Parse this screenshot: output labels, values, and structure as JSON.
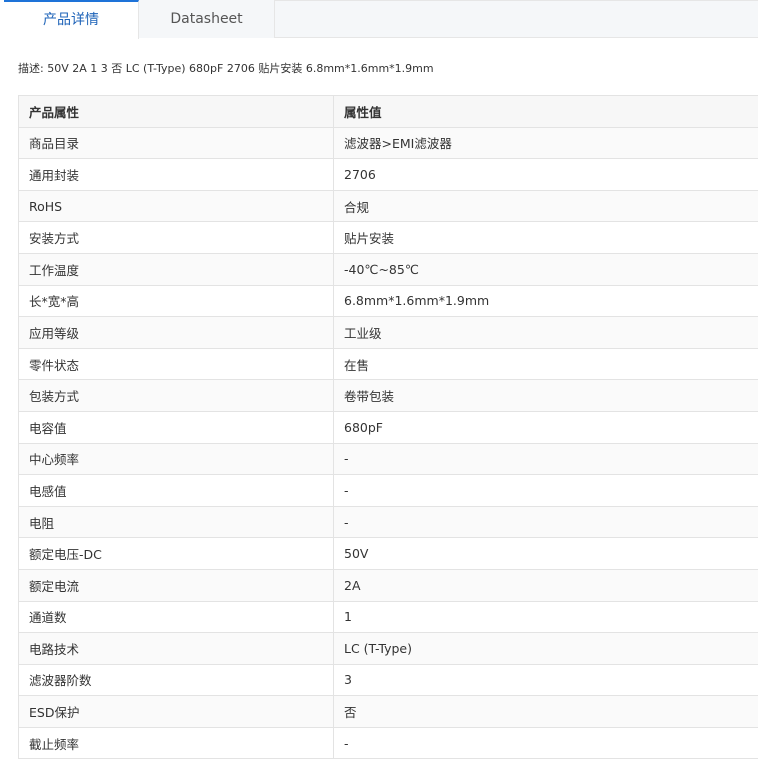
{
  "tabs": [
    {
      "label": "产品详情",
      "active": true
    },
    {
      "label": "Datasheet",
      "active": false
    }
  ],
  "description": "描述:  50V 2A 1 3 否 LC (T-Type) 680pF 2706 贴片安装 6.8mm*1.6mm*1.9mm",
  "table": {
    "headers": [
      "产品属性",
      "属性值"
    ],
    "rows": [
      [
        "商品目录",
        "滤波器>EMI滤波器"
      ],
      [
        "通用封装",
        "2706"
      ],
      [
        "RoHS",
        "合规"
      ],
      [
        "安装方式",
        "贴片安装"
      ],
      [
        "工作温度",
        "-40℃~85℃"
      ],
      [
        "长*宽*高",
        "6.8mm*1.6mm*1.9mm"
      ],
      [
        "应用等级",
        "工业级"
      ],
      [
        "零件状态",
        "在售"
      ],
      [
        "包装方式",
        "卷带包装"
      ],
      [
        "电容值",
        "680pF"
      ],
      [
        "中心频率",
        "-"
      ],
      [
        "电感值",
        "-"
      ],
      [
        "电阻",
        "-"
      ],
      [
        "额定电压-DC",
        "50V"
      ],
      [
        "额定电流",
        "2A"
      ],
      [
        "通道数",
        "1"
      ],
      [
        "电路技术",
        "LC (T-Type)"
      ],
      [
        "滤波器阶数",
        "3"
      ],
      [
        "ESD保护",
        "否"
      ],
      [
        "截止频率",
        "-"
      ]
    ]
  },
  "colors": {
    "accent": "#1e73d8",
    "active_tab_text": "#1e63b8",
    "header_bg": "#f7f7f7",
    "border": "#e3e3e3"
  }
}
